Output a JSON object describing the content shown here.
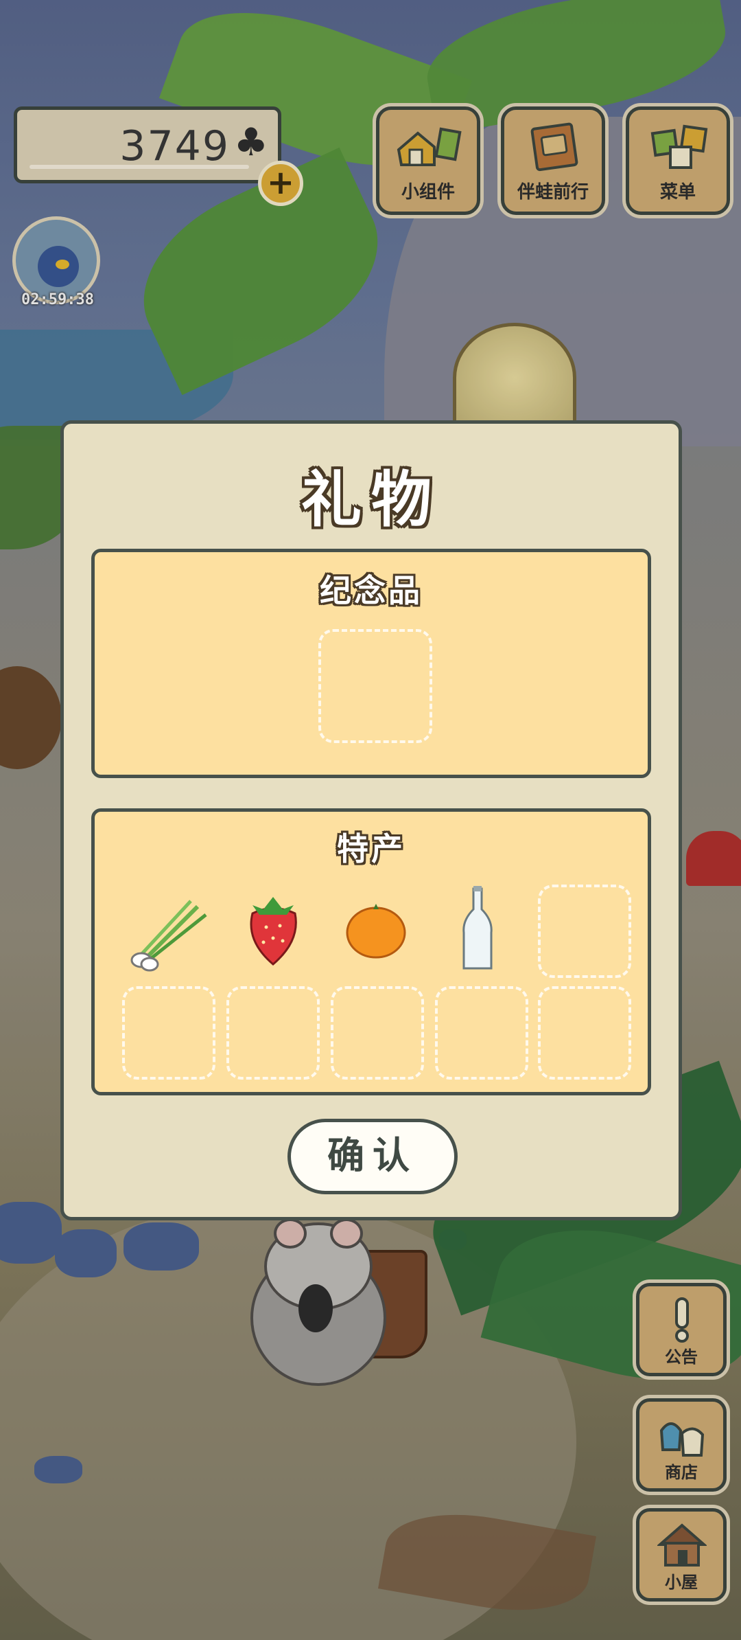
{
  "hud": {
    "clover_count": "3749",
    "clover_icon": "♣",
    "plus_label": "+",
    "timer": "02:59:38"
  },
  "top_menu": [
    {
      "label": "小组件",
      "icon": "widget-icon"
    },
    {
      "label": "伴蛙前行",
      "icon": "journey-book-icon"
    },
    {
      "label": "菜单",
      "icon": "menu-cards-icon"
    }
  ],
  "side_menu": [
    {
      "label": "公告",
      "icon": "exclamation-icon"
    },
    {
      "label": "商店",
      "icon": "shop-bags-icon"
    },
    {
      "label": "小屋",
      "icon": "house-icon"
    }
  ],
  "dialog": {
    "title": "礼物",
    "souvenir_title": "纪念品",
    "specialty_title": "特产",
    "specialty_items": [
      {
        "name": "green-onion-icon"
      },
      {
        "name": "strawberry-icon"
      },
      {
        "name": "orange-icon"
      },
      {
        "name": "glass-bottle-icon"
      }
    ],
    "confirm_label": "确认"
  },
  "colors": {
    "panel_fill": "#fde0a0",
    "dialog_fill": "#e7dfc2",
    "border": "#47514b",
    "accent_gold": "#e7b43b"
  }
}
